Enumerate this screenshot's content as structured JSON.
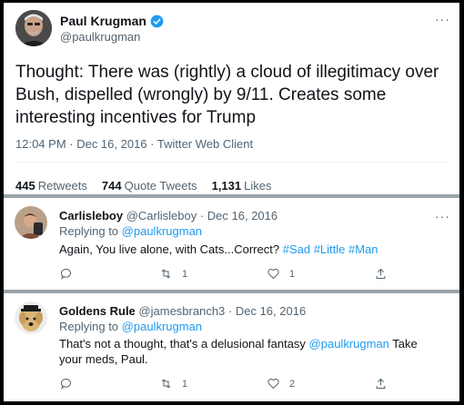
{
  "main_tweet": {
    "name": "Paul Krugman",
    "handle": "@paulkrugman",
    "more_label": "···",
    "text": "Thought: There was (rightly) a cloud of illegitimacy over Bush, dispelled (wrongly) by 9/11. Creates some interesting incentives for Trump",
    "meta": "12:04 PM · Dec 16, 2016 · Twitter Web Client",
    "stats": {
      "retweets_count": "445",
      "retweets_label": "Retweets",
      "quote_count": "744",
      "quote_label": "Quote Tweets",
      "likes_count": "1,131",
      "likes_label": "Likes"
    }
  },
  "replies": [
    {
      "name": "Carlisleboy",
      "handle": "@Carlisleboy",
      "date": "· Dec 16, 2016",
      "replying_prefix": "Replying to",
      "replying_handle": "@paulkrugman",
      "text_plain": "Again, You live alone, with Cats...Correct?",
      "hashtags": "#Sad #Little #Man",
      "retweet_count": "1",
      "like_count": "1",
      "more_label": "···"
    },
    {
      "name": "Goldens Rule",
      "handle": "@jamesbranch3",
      "date": "· Dec 16, 2016",
      "replying_prefix": "Replying to",
      "replying_handle": "@paulkrugman",
      "text_before": "That's not a thought, that's a delusional fantasy",
      "text_mention": "@paulkrugman",
      "text_after": "Take your meds, Paul.",
      "retweet_count": "1",
      "like_count": "2",
      "more_label": "···"
    }
  ],
  "colors": {
    "link": "#1d9bf0",
    "muted": "#536471",
    "separator_bar": "#9aa3a8",
    "verified": "#1d9bf0"
  }
}
